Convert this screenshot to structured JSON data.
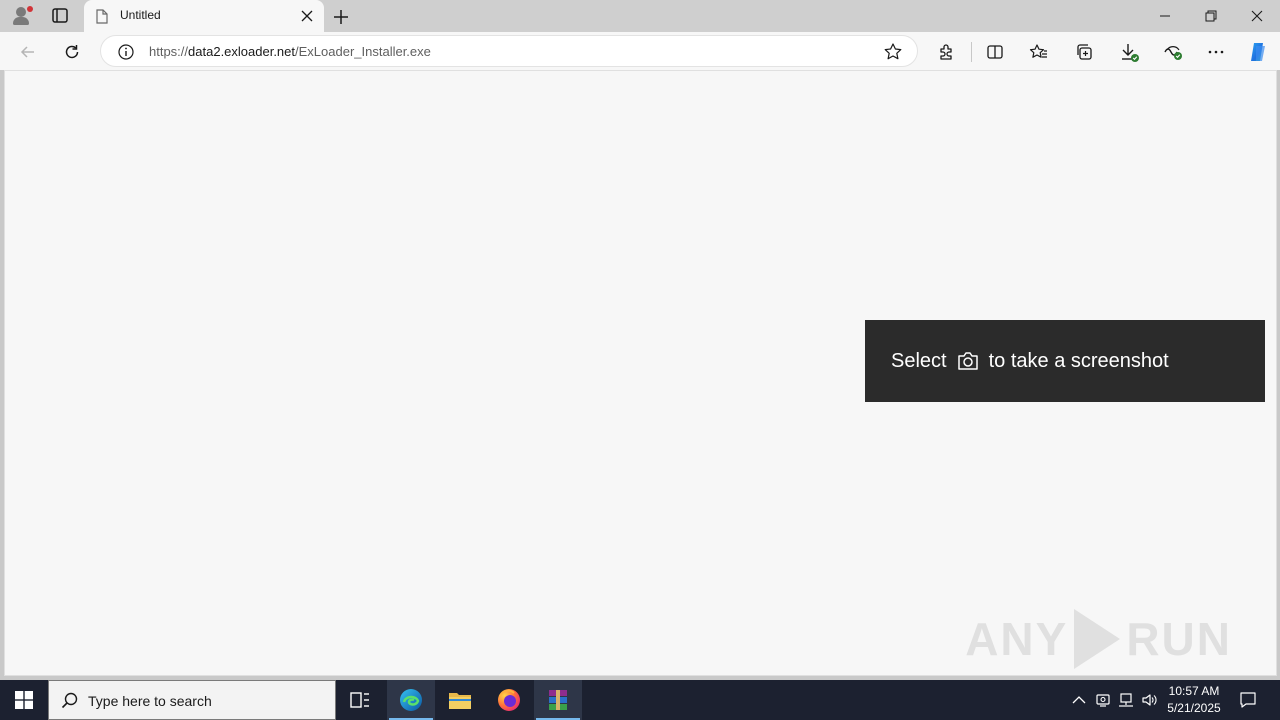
{
  "browser": {
    "tab": {
      "title": "Untitled"
    },
    "address": {
      "scheme": "https://",
      "host": "data2.exloader.net",
      "path": "/ExLoader_Installer.exe"
    }
  },
  "page": {
    "toast": {
      "prefix": "Select",
      "icon": "camera-icon",
      "suffix": "to take a screenshot"
    },
    "watermark": {
      "left": "ANY",
      "right": "RUN"
    }
  },
  "taskbar": {
    "search_placeholder": "Type here to search",
    "time": "10:57 AM",
    "date": "5/21/2025",
    "apps": [
      "task-view",
      "edge",
      "file-explorer",
      "firefox",
      "winrar"
    ]
  },
  "colors": {
    "accent": "#76b9ed",
    "taskbar": "#1c2130",
    "toast": "#2b2b2b",
    "profile_badge": "#d13438"
  }
}
